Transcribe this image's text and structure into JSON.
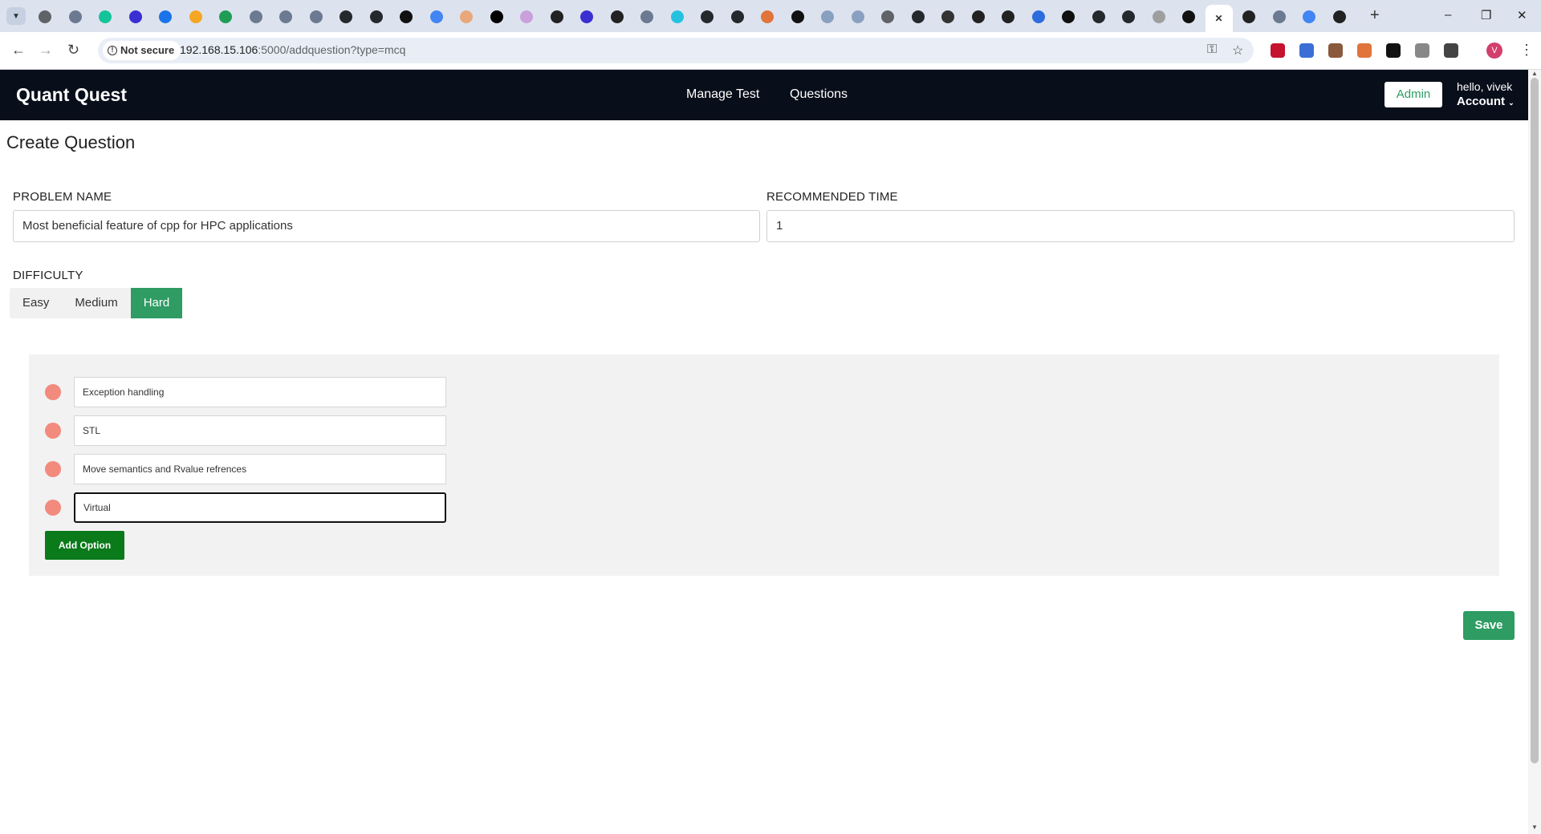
{
  "browser": {
    "security_label": "Not secure",
    "url_host": "192.168.15.106",
    "url_rest": ":5000/addquestion?type=mcq",
    "profile_initial": "V",
    "tabs": [
      {
        "icon": "chrome-icon",
        "color": "#5f6368"
      },
      {
        "icon": "globe-icon",
        "color": "#6b7a90"
      },
      {
        "icon": "grammarly-icon",
        "color": "#15c39a"
      },
      {
        "icon": "cube-icon",
        "color": "#3a2fd1"
      },
      {
        "icon": "sync-icon",
        "color": "#1a73e8"
      },
      {
        "icon": "folder-icon",
        "color": "#f5a623"
      },
      {
        "icon": "n-icon",
        "color": "#1f9d55"
      },
      {
        "icon": "globe-icon",
        "color": "#6b7a90"
      },
      {
        "icon": "globe-icon",
        "color": "#6b7a90"
      },
      {
        "icon": "globe-icon",
        "color": "#6b7a90"
      },
      {
        "icon": "github-icon",
        "color": "#24292e"
      },
      {
        "icon": "github-icon",
        "color": "#24292e"
      },
      {
        "icon": "ai-icon",
        "color": "#111111"
      },
      {
        "icon": "google-icon",
        "color": "#4285f4"
      },
      {
        "icon": "location-icon",
        "color": "#e8a87c"
      },
      {
        "icon": "medium-icon",
        "color": "#000000"
      },
      {
        "icon": "blank-icon",
        "color": "#c9a0dc"
      },
      {
        "icon": "target-icon",
        "color": "#222222"
      },
      {
        "icon": "cube-icon",
        "color": "#3a2fd1"
      },
      {
        "icon": "x-icon",
        "color": "#222222"
      },
      {
        "icon": "globe-icon",
        "color": "#6b7a90"
      },
      {
        "icon": "bookmark-icon",
        "color": "#27c1e0"
      },
      {
        "icon": "github-icon",
        "color": "#24292e"
      },
      {
        "icon": "github-icon",
        "color": "#24292e"
      },
      {
        "icon": "cake-icon",
        "color": "#e0743a"
      },
      {
        "icon": "square-icon",
        "color": "#111111"
      },
      {
        "icon": "fish-icon",
        "color": "#8aa0c0"
      },
      {
        "icon": "fish-icon",
        "color": "#8aa0c0"
      },
      {
        "icon": "chrome-icon",
        "color": "#5f6368"
      },
      {
        "icon": "github-icon",
        "color": "#24292e"
      },
      {
        "icon": "bug-icon",
        "color": "#333333"
      },
      {
        "icon": "x-icon",
        "color": "#222222"
      },
      {
        "icon": "target-icon",
        "color": "#222222"
      },
      {
        "icon": "globe-icon",
        "color": "#2d6cdf"
      },
      {
        "icon": "hex-icon",
        "color": "#111111"
      },
      {
        "icon": "github-icon",
        "color": "#24292e"
      },
      {
        "icon": "github-icon",
        "color": "#24292e"
      },
      {
        "icon": "doc-icon",
        "color": "#9e9e9e"
      },
      {
        "icon": "mi-icon",
        "color": "#111111"
      },
      {
        "icon": "close-icon",
        "color": "#333333",
        "active": true
      },
      {
        "icon": "target-icon",
        "color": "#222222"
      },
      {
        "icon": "globe-icon",
        "color": "#6b7a90"
      },
      {
        "icon": "google-icon",
        "color": "#4285f4"
      },
      {
        "icon": "target-icon",
        "color": "#222222"
      }
    ],
    "extensions": [
      "#c4122f",
      "#3b6fd6",
      "#8a5a3c",
      "#e0743a",
      "#111111",
      "#888888",
      "#444444"
    ]
  },
  "app": {
    "brand": "Quant Quest",
    "nav": [
      "Manage Test",
      "Questions"
    ],
    "admin_label": "Admin",
    "greeting": "hello, vivek",
    "account_label": "Account"
  },
  "form": {
    "title": "Create Question",
    "problem_name_label": "PROBLEM NAME",
    "problem_name_value": "Most beneficial feature of cpp for HPC applications",
    "recommended_time_label": "RECOMMENDED TIME",
    "recommended_time_value": "1",
    "difficulty_label": "DIFFICULTY",
    "difficulty_options": [
      "Easy",
      "Medium",
      "Hard"
    ],
    "difficulty_selected": "Hard",
    "options": [
      "Exception handling",
      "STL",
      "Move semantics and Rvalue refrences",
      "Virtual"
    ],
    "add_option_label": "Add Option",
    "save_label": "Save"
  }
}
